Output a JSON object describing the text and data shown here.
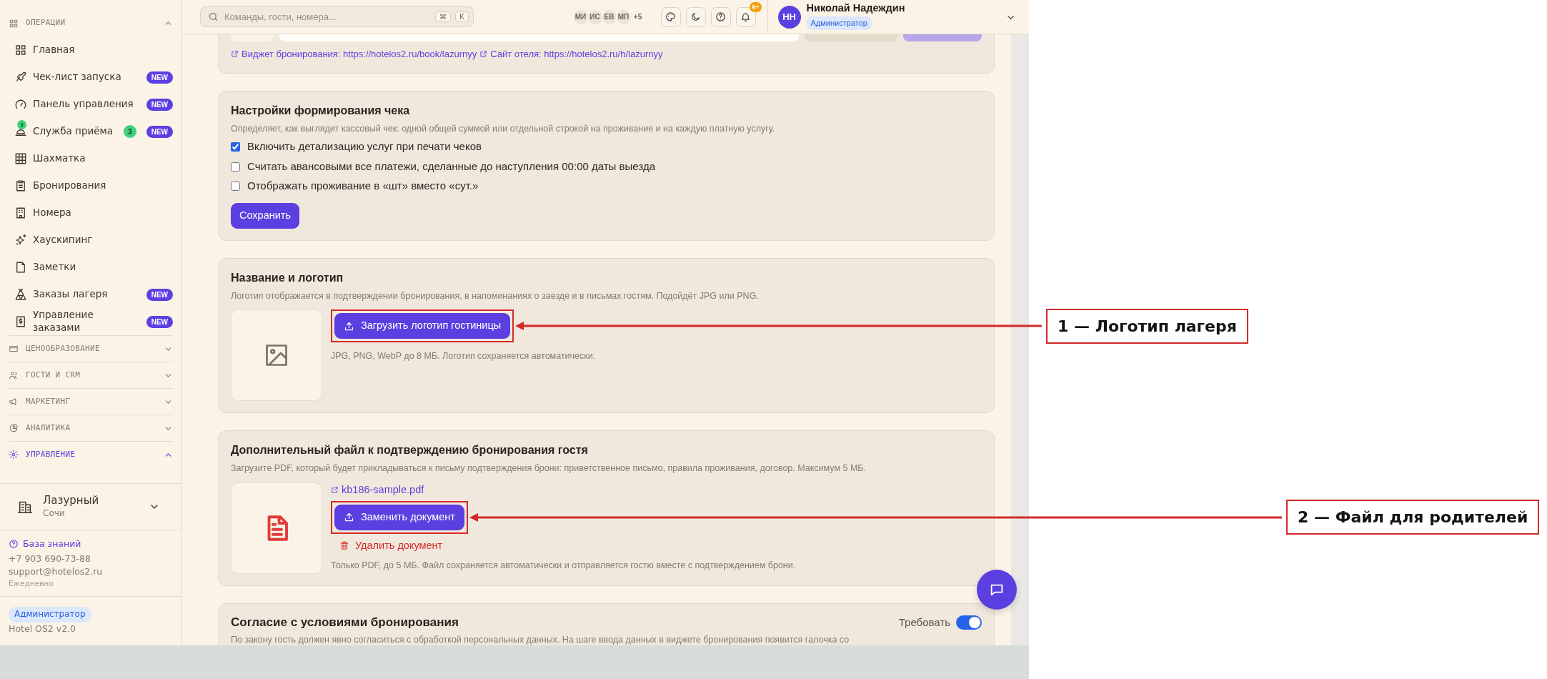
{
  "header": {
    "search": {
      "placeholder": "Команды, гости, номера...",
      "keys": [
        "⌘",
        "K"
      ]
    },
    "avatars": [
      "МИ",
      "ИС",
      "ЕВ",
      "МП"
    ],
    "avatars_more": "+5",
    "notifications": "9+",
    "user": {
      "initials": "НН",
      "name": "Николай Надеждин",
      "role": "Администратор"
    }
  },
  "sidebar": {
    "sections": [
      {
        "title": "ОПЕРАЦИИ",
        "expanded": true,
        "selected": false,
        "items": [
          {
            "label": "Главная"
          },
          {
            "label": "Чек-лист запуска",
            "badge": "NEW"
          },
          {
            "label": "Панель управления",
            "badge": "NEW"
          },
          {
            "label": "Служба приёма",
            "icon_count": "3",
            "count": "3",
            "badge": "NEW"
          },
          {
            "label": "Шахматка"
          },
          {
            "label": "Бронирования"
          },
          {
            "label": "Номера"
          },
          {
            "label": "Хаускипинг"
          },
          {
            "label": "Заметки"
          },
          {
            "label": "Заказы лагеря",
            "badge": "NEW"
          },
          {
            "label": "Управление заказами",
            "badge": "NEW"
          }
        ]
      },
      {
        "title": "ЦЕНООБРАЗОВАНИЕ",
        "expanded": false,
        "selected": false
      },
      {
        "title": "ГОСТИ И CRM",
        "expanded": false,
        "selected": false
      },
      {
        "title": "МАРКЕТИНГ",
        "expanded": false,
        "selected": false
      },
      {
        "title": "АНАЛИТИКА",
        "expanded": false,
        "selected": false
      },
      {
        "title": "УПРАВЛЕНИЕ",
        "expanded": true,
        "selected": true
      }
    ],
    "property": {
      "name": "Лазурный",
      "city": "Сочи"
    },
    "help_link": "База знаний",
    "phone": "+7 903 690-73-88",
    "email": "support@hotelos2.ru",
    "hours": "Ежедневно",
    "role": "Администратор",
    "version": "Hotel OS2 v2.0"
  },
  "cards": [
    {
      "kind": "links",
      "links": [
        "Виджет бронирования: https://hotelos2.ru/book/lazurnyy",
        "Сайт отеля: https://hotelos2.ru/h/lazurnyy"
      ]
    },
    {
      "kind": "checkboxes",
      "title": "Настройки формирования чека",
      "description": "Определяет, как выглядит кассовый чек: одной общей суммой или отдельной строкой на проживание и на каждую платную услугу.",
      "options": [
        {
          "label": "Включить детализацию услуг при печати чеков",
          "checked": true
        },
        {
          "label": "Считать авансовыми все платежи, сделанные до наступления 00:00 даты выезда",
          "checked": false
        },
        {
          "label": "Отображать проживание в «шт» вместо «сут.»",
          "checked": false
        }
      ],
      "button": "Сохранить"
    },
    {
      "kind": "logo",
      "title": "Название и логотип",
      "description": "Логотип отображается в подтверждении бронирования, в напоминаниях о заезде и в письмах гостям. Подойдёт JPG или PNG.",
      "button": {
        "label": "Загрузить логотип гостиницы",
        "annotation": "1 — Логотип лагеря"
      },
      "note": "JPG, PNG, WebP до 8 МБ. Логотип сохраняется автоматически."
    },
    {
      "kind": "file",
      "title": "Дополнительный файл к подтверждению бронирования гостя",
      "description": "Загрузите PDF, который будет прикладываться к письму подтверждения брони: приветственное письмо, правила проживания, договор. Максимум 5 МБ.",
      "file": "kb186-sample.pdf",
      "button": {
        "label": "Заменить документ",
        "annotation": "2 — Файл для родителей"
      },
      "delete": "Удалить документ",
      "note": "Только PDF, до 5 МБ. Файл сохраняется автоматически и отправляется гостю вместе с подтверждением брони."
    },
    {
      "kind": "toggle",
      "title": "Согласие с условиями бронирования",
      "toggle_label": "Требовать",
      "on": true,
      "description": "По закону гость должен явно согласиться с обработкой персональных данных. На шаге ввода данных в виджете бронирования появится галочка со"
    }
  ]
}
